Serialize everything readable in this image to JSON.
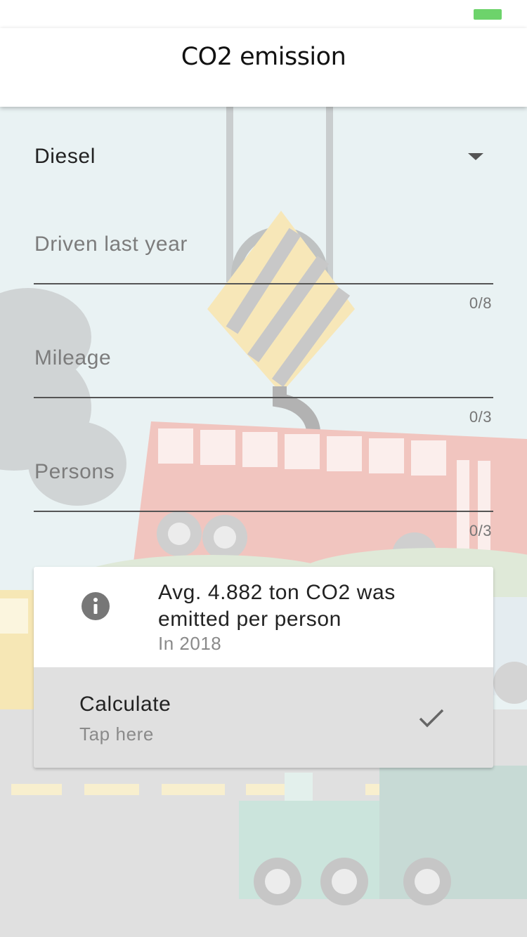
{
  "app": {
    "title": "CO2 emission",
    "battery_color": "#6dd36b"
  },
  "form": {
    "fuel_type": {
      "value": "Diesel"
    },
    "fields": [
      {
        "placeholder": "Driven last year",
        "counter": "0/8"
      },
      {
        "placeholder": "Mileage",
        "counter": "0/3"
      },
      {
        "placeholder": "Persons",
        "counter": "0/3"
      }
    ]
  },
  "info": {
    "icon": "info-icon",
    "text": "Avg. 4.882 ton CO2 was emitted per person",
    "subtext": "In 2018"
  },
  "calculate": {
    "title": "Calculate",
    "subtitle": "Tap here",
    "icon": "check-icon"
  }
}
